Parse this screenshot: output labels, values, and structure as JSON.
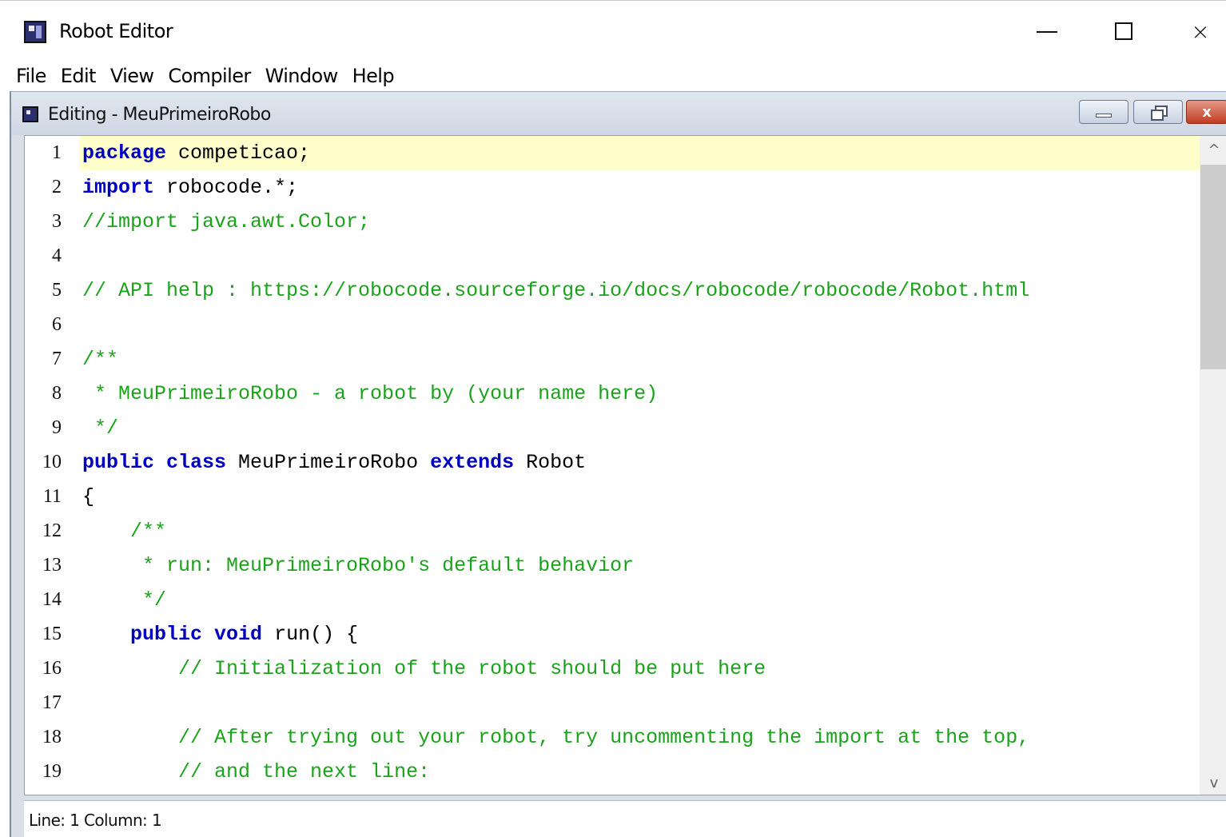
{
  "window": {
    "title": "Robot Editor",
    "icon": "robot-editor-app-icon",
    "controls": {
      "minimize": "minimize-icon",
      "maximize": "maximize-icon",
      "close": "×"
    }
  },
  "menu": [
    "File",
    "Edit",
    "View",
    "Compiler",
    "Window",
    "Help"
  ],
  "frame": {
    "title": "Editing - MeuPrimeiroRobo",
    "close_glyph": "x"
  },
  "editor": {
    "current_line": 1,
    "lines": [
      [
        {
          "t": "kw",
          "s": "package"
        },
        {
          "t": "tx",
          "s": " competicao;"
        }
      ],
      [
        {
          "t": "kw",
          "s": "import"
        },
        {
          "t": "tx",
          "s": " robocode.*;"
        }
      ],
      [
        {
          "t": "cm",
          "s": "//import java.awt.Color;"
        }
      ],
      [],
      [
        {
          "t": "cm",
          "s": "// API help : https://robocode.sourceforge.io/docs/robocode/robocode/Robot.html"
        }
      ],
      [],
      [
        {
          "t": "cm",
          "s": "/**"
        }
      ],
      [
        {
          "t": "cm",
          "s": " * MeuPrimeiroRobo - a robot by (your name here)"
        }
      ],
      [
        {
          "t": "cm",
          "s": " */"
        }
      ],
      [
        {
          "t": "kw",
          "s": "public"
        },
        {
          "t": "tx",
          "s": " "
        },
        {
          "t": "kw",
          "s": "class"
        },
        {
          "t": "tx",
          "s": " MeuPrimeiroRobo "
        },
        {
          "t": "kw",
          "s": "extends"
        },
        {
          "t": "tx",
          "s": " Robot"
        }
      ],
      [
        {
          "t": "tx",
          "s": "{"
        }
      ],
      [
        {
          "t": "cm",
          "s": "    /**"
        }
      ],
      [
        {
          "t": "cm",
          "s": "     * run: MeuPrimeiroRobo's default behavior"
        }
      ],
      [
        {
          "t": "cm",
          "s": "     */"
        }
      ],
      [
        {
          "t": "tx",
          "s": "    "
        },
        {
          "t": "kw",
          "s": "public"
        },
        {
          "t": "tx",
          "s": " "
        },
        {
          "t": "kw",
          "s": "void"
        },
        {
          "t": "tx",
          "s": " run() {"
        }
      ],
      [
        {
          "t": "cm",
          "s": "        // Initialization of the robot should be put here"
        }
      ],
      [],
      [
        {
          "t": "cm",
          "s": "        // After trying out your robot, try uncommenting the import at the top,"
        }
      ],
      [
        {
          "t": "cm",
          "s": "        // and the next line:"
        }
      ]
    ]
  },
  "scrollbar": {
    "up_glyph": "^",
    "down_glyph": "v"
  },
  "status": "Line: 1 Column: 1"
}
